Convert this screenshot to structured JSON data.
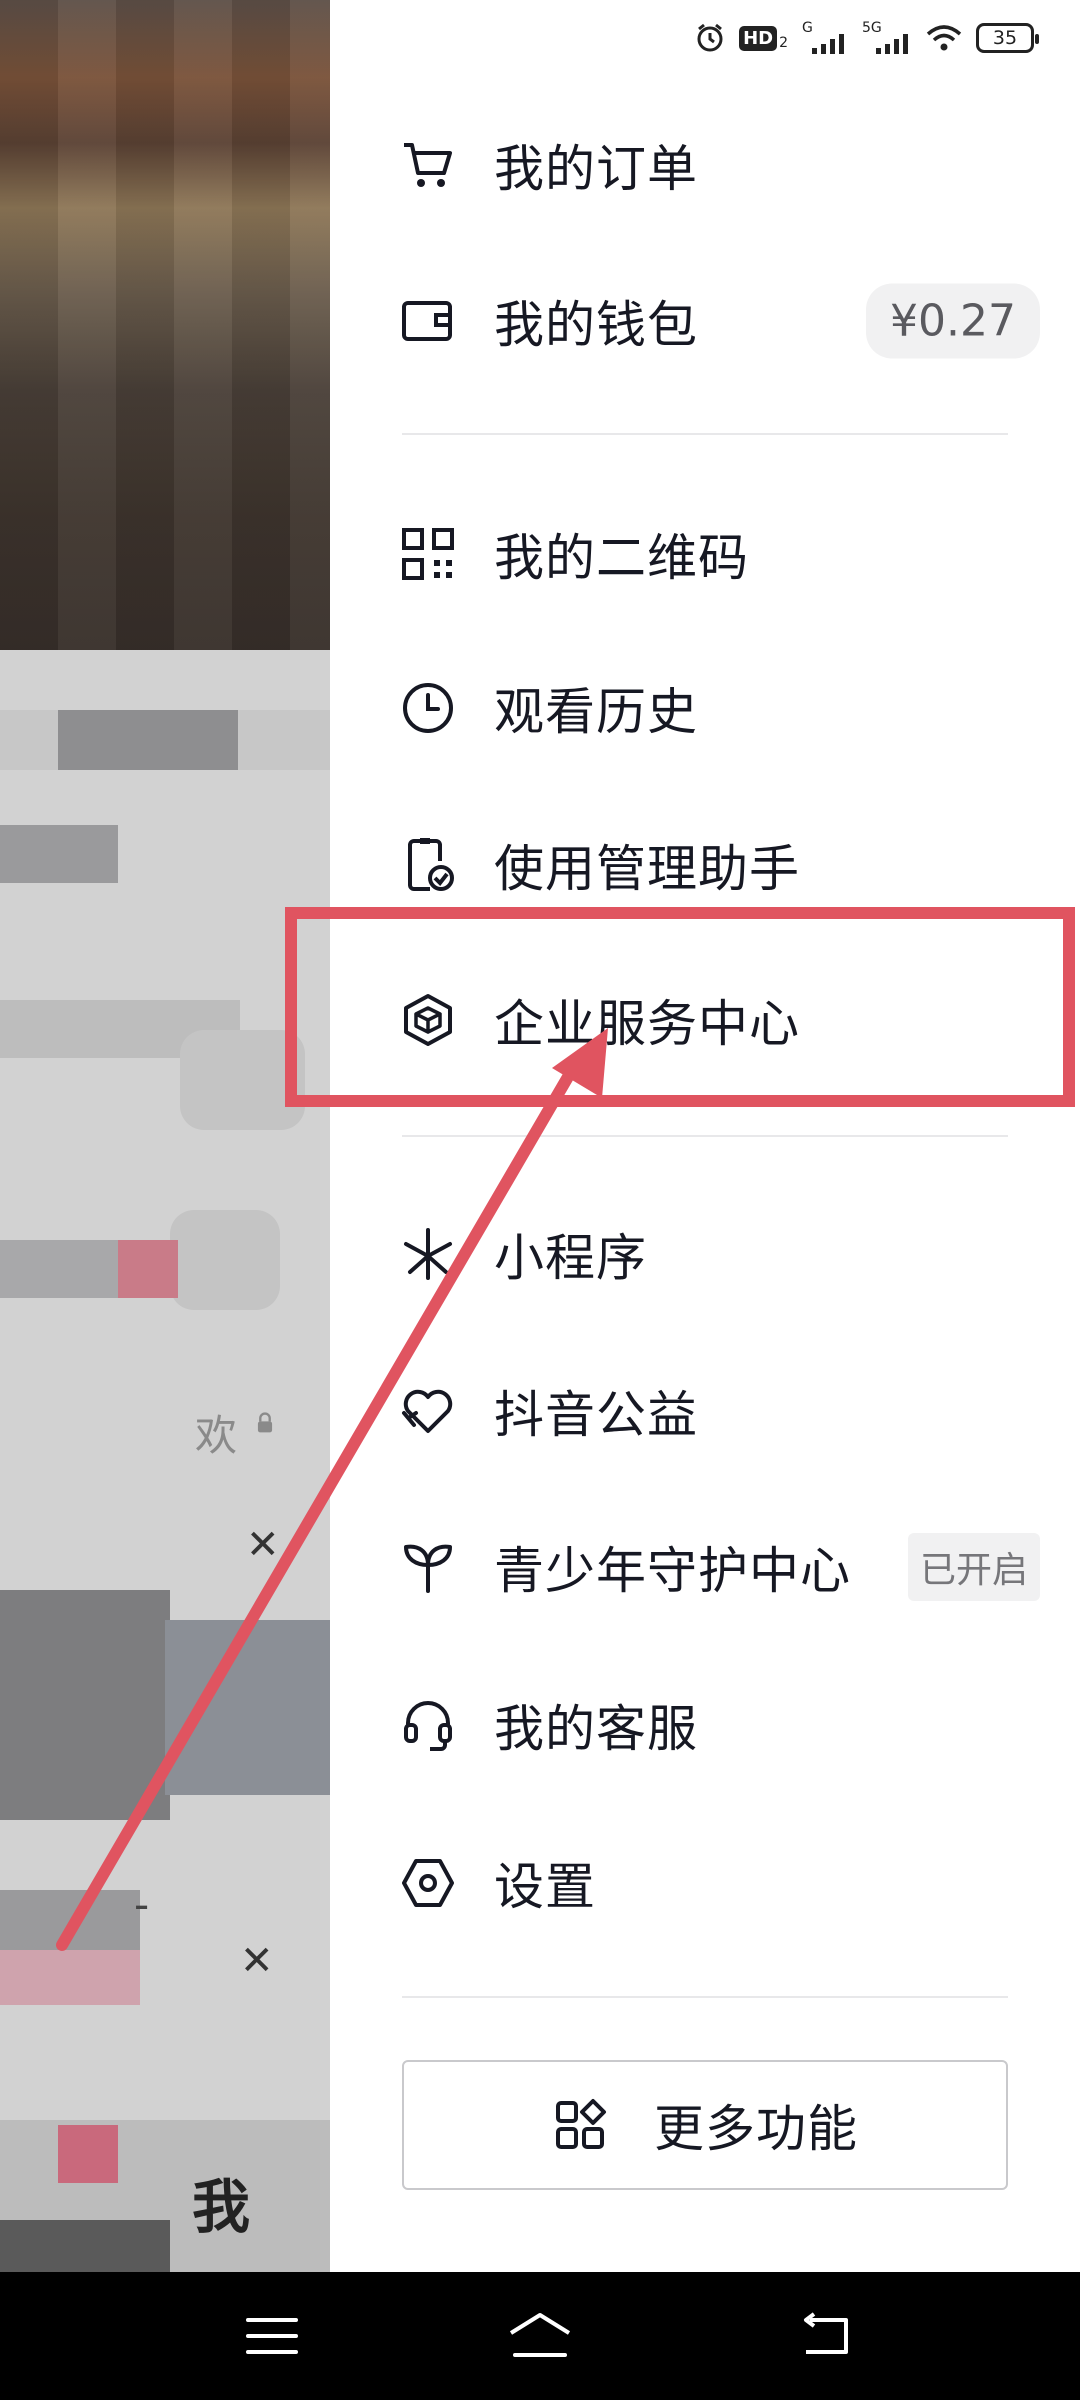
{
  "status_bar": {
    "network_hd": "HD",
    "hd_sub": "2",
    "network_g": "G",
    "network_5g": "5G",
    "battery": "35"
  },
  "menu": {
    "orders": "我的订单",
    "wallet": "我的钱包",
    "wallet_balance": "¥0.27",
    "qrcode": "我的二维码",
    "history": "观看历史",
    "usage_assistant": "使用管理助手",
    "enterprise_center": "企业服务中心",
    "mini_programs": "小程序",
    "douyin_charity": "抖音公益",
    "youth_protection": "青少年守护中心",
    "youth_protection_status": "已开启",
    "customer_service": "我的客服",
    "settings": "设置",
    "more_features": "更多功能"
  },
  "left_pane": {
    "like_fragment": "欢",
    "me_tab": "我",
    "dash": "-"
  },
  "colors": {
    "annotation": "#e05460",
    "text": "#161823"
  },
  "icons": {
    "orders": "cart-icon",
    "wallet": "wallet-icon",
    "qrcode": "qrcode-icon",
    "history": "clock-icon",
    "usage_assistant": "phone-check-icon",
    "enterprise_center": "cube-icon",
    "mini_programs": "asterisk-icon",
    "douyin_charity": "heart-hand-icon",
    "youth_protection": "sprout-icon",
    "customer_service": "headset-icon",
    "settings": "hexagon-gear-icon",
    "more_features": "apps-grid-icon"
  }
}
